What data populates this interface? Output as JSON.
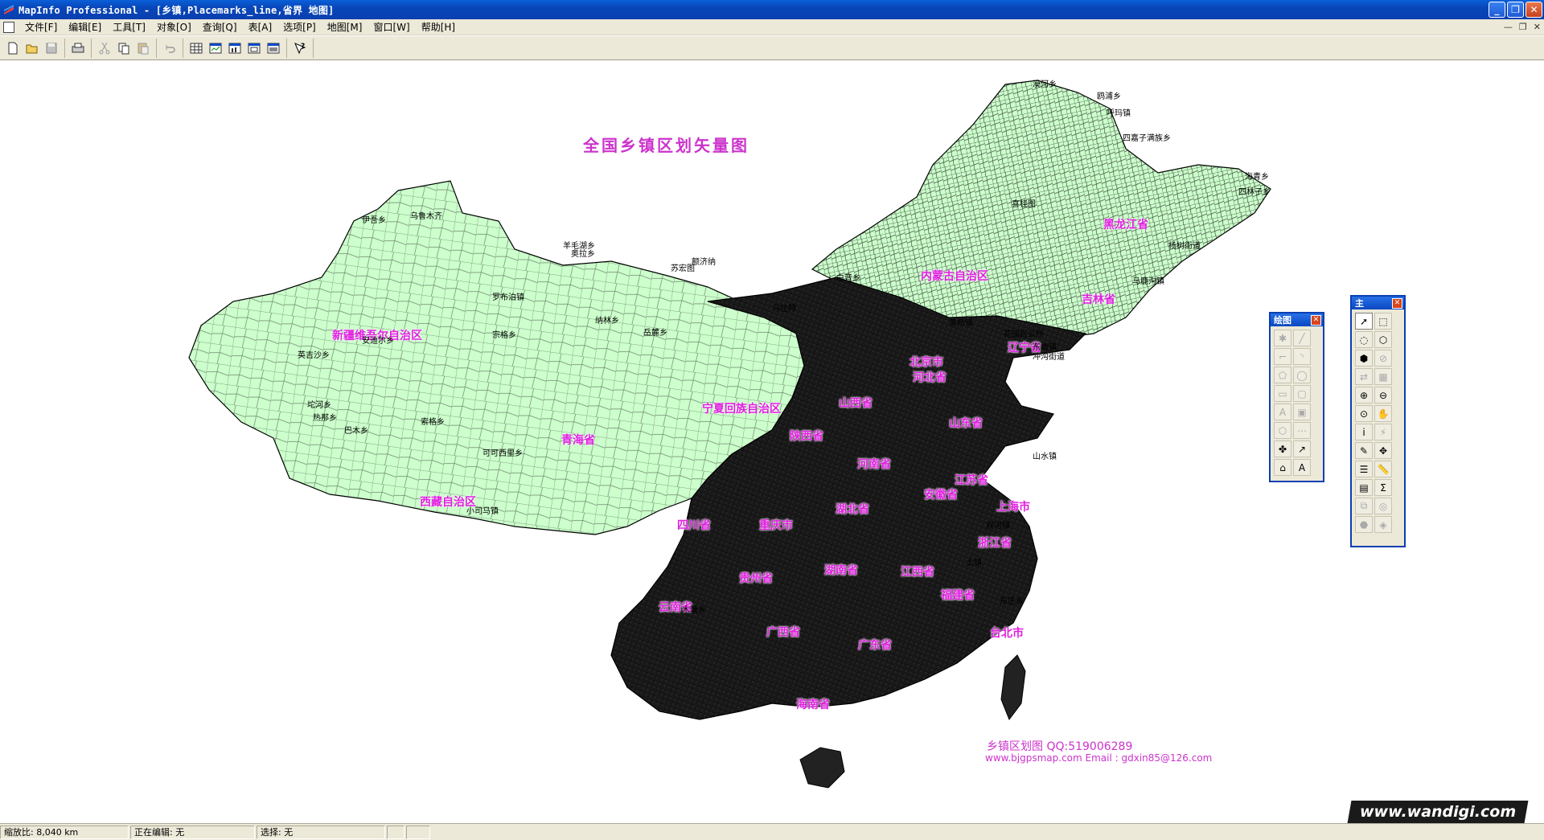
{
  "window": {
    "title": "MapInfo Professional - [乡镇,Placemarks_line,省界 地图]",
    "minimize": "_",
    "restore": "❐",
    "close": "✕"
  },
  "menu": [
    {
      "label": "文件[F]"
    },
    {
      "label": "编辑[E]"
    },
    {
      "label": "工具[T]"
    },
    {
      "label": "对象[O]"
    },
    {
      "label": "查询[Q]"
    },
    {
      "label": "表[A]"
    },
    {
      "label": "选项[P]"
    },
    {
      "label": "地图[M]"
    },
    {
      "label": "窗口[W]"
    },
    {
      "label": "帮助[H]"
    }
  ],
  "mdi_controls": {
    "minimize": "—",
    "restore": "❐",
    "close": "✕"
  },
  "map": {
    "title": "全国乡镇区划矢量图",
    "provinces": [
      {
        "name": "新疆维吾尔自治区"
      },
      {
        "name": "内蒙古自治区"
      },
      {
        "name": "黑龙江省"
      },
      {
        "name": "吉林省"
      },
      {
        "name": "辽宁省"
      },
      {
        "name": "北京市"
      },
      {
        "name": "河北省"
      },
      {
        "name": "山西省"
      },
      {
        "name": "宁夏回族自治区"
      },
      {
        "name": "山东省"
      },
      {
        "name": "陕西省"
      },
      {
        "name": "青海省"
      },
      {
        "name": "河南省"
      },
      {
        "name": "江苏省"
      },
      {
        "name": "安徽省"
      },
      {
        "name": "西藏自治区"
      },
      {
        "name": "湖北省"
      },
      {
        "name": "上海市"
      },
      {
        "name": "四川省"
      },
      {
        "name": "重庆市"
      },
      {
        "name": "浙江省"
      },
      {
        "name": "湖南省"
      },
      {
        "name": "江西省"
      },
      {
        "name": "贵州省"
      },
      {
        "name": "福建省"
      },
      {
        "name": "云南省"
      },
      {
        "name": "广西省"
      },
      {
        "name": "广东省"
      },
      {
        "name": "台北市"
      },
      {
        "name": "海南省"
      }
    ],
    "towns": [
      "漠河乡",
      "鸥浦乡",
      "呼玛镇",
      "四嘉子满族乡",
      "海青乡",
      "四林子乡",
      "杨树街道",
      "马鹿沟镇",
      "罗布泊镇",
      "花园区公所",
      "东坡镇",
      "冲沟街道",
      "土镇",
      "东庄乡",
      "木塘乡",
      "坨河乡",
      "热那乡",
      "巴木乡",
      "索格乡",
      "安迪尔乡",
      "可可西里乡",
      "伊吾乡",
      "小司马镇",
      "宗格乡",
      "英吉沙乡",
      "乌鲁木齐",
      "额济纳",
      "乌拉特",
      "羊毛湖乡",
      "苏宏图",
      "奥拉乡",
      "岳麓乡",
      "纳林乡",
      "白音乡",
      "喜桂图",
      "黄桥镇",
      "双河镇",
      "山水镇"
    ],
    "credit_line1": "乡镇区划图  QQ:519006289",
    "credit_line2": "www.bjgpsmap.com       Email : gdxin85@126.com"
  },
  "palette_draw": {
    "title": "绘图",
    "close": "✕"
  },
  "palette_main": {
    "title": "主",
    "close": "✕"
  },
  "status": {
    "zoom": "缩放比: 8,040 km",
    "editing": "正在编辑: 无",
    "selection": "选择: 无"
  },
  "brand": "www.wandigi.com",
  "colors": {
    "land_fill": "#ccffcc",
    "boundary": "#000000",
    "label": "#e020e0",
    "title_bar": "#0a48c0"
  },
  "icons": {
    "toolbar": [
      "new-icon",
      "open-icon",
      "save-icon",
      "print-icon",
      "cut-icon",
      "copy-icon",
      "paste-icon",
      "undo-icon",
      "browser-icon",
      "map-window-icon",
      "graph-icon",
      "layout-icon",
      "redistrict-icon",
      "help-icon"
    ]
  }
}
